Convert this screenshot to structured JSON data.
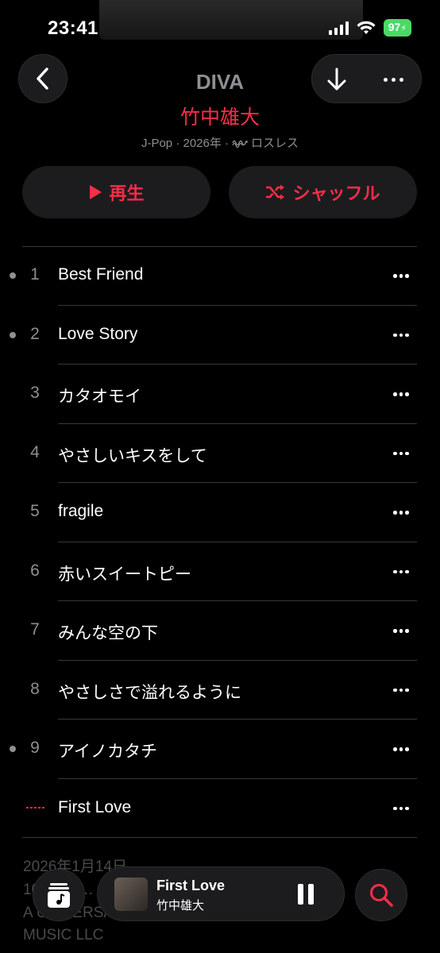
{
  "status": {
    "time": "23:41",
    "battery": "97"
  },
  "album": {
    "title": "DIVA",
    "artist": "竹中雄大",
    "meta_prefix": "J-Pop · 2026年 ·",
    "meta_lossless": "ロスレス"
  },
  "actions": {
    "play": "再生",
    "shuffle": "シャッフル"
  },
  "tracks": [
    {
      "num": "1",
      "title": "Best Friend",
      "downloaded": true
    },
    {
      "num": "2",
      "title": "Love Story",
      "downloaded": true
    },
    {
      "num": "3",
      "title": "カタオモイ",
      "downloaded": false
    },
    {
      "num": "4",
      "title": "やさしいキスをして",
      "downloaded": false
    },
    {
      "num": "5",
      "title": "fragile",
      "downloaded": false
    },
    {
      "num": "6",
      "title": "赤いスイートピー",
      "downloaded": false
    },
    {
      "num": "7",
      "title": "みんな空の下",
      "downloaded": false
    },
    {
      "num": "8",
      "title": "やさしさで溢れるように",
      "downloaded": false
    },
    {
      "num": "9",
      "title": "アイノカタチ",
      "downloaded": true
    },
    {
      "num": "",
      "title": "First Love",
      "downloaded": false,
      "playing": true
    }
  ],
  "footer": {
    "line1": "2026年1月14日",
    "line2": "10曲、4…",
    "line3": "A UNIVERSAL … UNIVERSAL",
    "line4": "MUSIC LLC"
  },
  "mini_player": {
    "title": "First Love",
    "artist": "竹中雄大"
  },
  "icons": {
    "back": "chevron-left-icon",
    "download": "arrow-down-icon",
    "more": "ellipsis-icon",
    "play": "play-icon",
    "shuffle": "shuffle-icon",
    "library": "library-icon",
    "pause": "pause-icon",
    "search": "search-icon"
  },
  "colors": {
    "accent": "#fa2d48",
    "background": "#000000",
    "surface": "#1c1c1e",
    "battery": "#4cd964"
  }
}
